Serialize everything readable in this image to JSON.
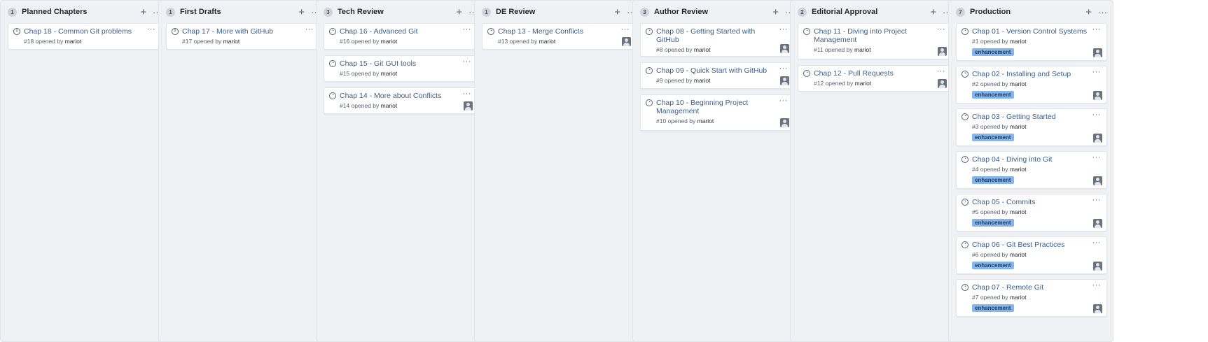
{
  "board": {
    "columns": [
      {
        "count": "1",
        "title": "Planned Chapters",
        "cards": [
          {
            "title": "Chap 18 - Common Git problems",
            "meta": "#18 opened by",
            "user": "mariot",
            "avatar": false,
            "label": ""
          }
        ]
      },
      {
        "count": "1",
        "title": "First Drafts",
        "cards": [
          {
            "title": "Chap 17 - More with GitHub",
            "meta": "#17 opened by",
            "user": "mariot",
            "avatar": false,
            "label": ""
          }
        ]
      },
      {
        "count": "3",
        "title": "Tech Review",
        "cards": [
          {
            "title": "Chap 16 - Advanced Git",
            "meta": "#16 opened by",
            "user": "mariot",
            "avatar": false,
            "label": ""
          },
          {
            "title": "Chap 15 - Git GUI tools",
            "meta": "#15 opened by",
            "user": "mariot",
            "avatar": false,
            "label": ""
          },
          {
            "title": "Chap 14 - More about Conflicts",
            "meta": "#14 opened by",
            "user": "mariot",
            "avatar": true,
            "label": ""
          }
        ]
      },
      {
        "count": "1",
        "title": "DE Review",
        "cards": [
          {
            "title": "Chap 13 - Merge Conflicts",
            "meta": "#13 opened by",
            "user": "mariot",
            "avatar": true,
            "label": ""
          }
        ]
      },
      {
        "count": "3",
        "title": "Author Review",
        "cards": [
          {
            "title": "Chap 08 - Getting Started with GitHub",
            "meta": "#8 opened by",
            "user": "mariot",
            "avatar": true,
            "label": ""
          },
          {
            "title": "Chap 09 - Quick Start with GitHub",
            "meta": "#9 opened by",
            "user": "mariot",
            "avatar": true,
            "label": ""
          },
          {
            "title": "Chap 10 - Beginning Project Management",
            "meta": "#10 opened by",
            "user": "mariot",
            "avatar": true,
            "label": ""
          }
        ]
      },
      {
        "count": "2",
        "title": "Editorial Approval",
        "cards": [
          {
            "title": "Chap 11 - Diving into Project Management",
            "meta": "#11 opened by",
            "user": "mariot",
            "avatar": true,
            "label": ""
          },
          {
            "title": "Chap 12 - Pull Requests",
            "meta": "#12 opened by",
            "user": "mariot",
            "avatar": true,
            "label": ""
          }
        ]
      },
      {
        "count": "7",
        "title": "Production",
        "cards": [
          {
            "title": "Chap 01 - Version Control Systems",
            "meta": "#1 opened by",
            "user": "mariot",
            "avatar": true,
            "label": "enhancement"
          },
          {
            "title": "Chap 02 - Installing and Setup",
            "meta": "#2 opened by",
            "user": "mariot",
            "avatar": true,
            "label": "enhancement"
          },
          {
            "title": "Chap 03 - Getting Started",
            "meta": "#3 opened by",
            "user": "mariot",
            "avatar": true,
            "label": "enhancement"
          },
          {
            "title": "Chap 04 - Diving into Git",
            "meta": "#4 opened by",
            "user": "mariot",
            "avatar": true,
            "label": "enhancement"
          },
          {
            "title": "Chap 05 - Commits",
            "meta": "#5 opened by",
            "user": "mariot",
            "avatar": true,
            "label": "enhancement"
          },
          {
            "title": "Chap 06 - Git Best Practices",
            "meta": "#6 opened by",
            "user": "mariot",
            "avatar": true,
            "label": "enhancement"
          },
          {
            "title": "Chap 07 - Remote Git",
            "meta": "#7 opened by",
            "user": "mariot",
            "avatar": true,
            "label": "enhancement"
          }
        ]
      }
    ]
  },
  "icons": {
    "add": "plus-icon",
    "menu": "kebab-menu-icon",
    "open_issue": "issue-opened-icon",
    "in_progress": "issue-progress-icon"
  },
  "colors": {
    "column_bg": "#eff1f4",
    "card_title": "#3a5f8c",
    "label_bg": "#84b6eb"
  }
}
